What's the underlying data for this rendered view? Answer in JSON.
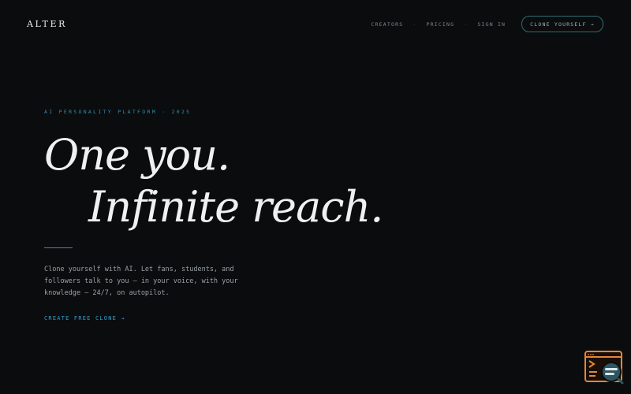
{
  "header": {
    "logo": "ALTER",
    "nav": {
      "items": [
        "CREATORS",
        "PRICING",
        "SIGN IN"
      ],
      "separator": "·",
      "cta_label": "CLONE YOURSELF →"
    }
  },
  "hero": {
    "eyebrow": "AI PERSONALITY PLATFORM · 2025",
    "headline_line1": "One you.",
    "headline_line2": "Infinite reach.",
    "description": "Clone yourself with AI. Let fans, students, and followers talk to you — in your voice, with your knowledge — 24/7, on autopilot.",
    "cta_label": "CREATE FREE CLONE →"
  },
  "colors": {
    "background": "#0b0c0d",
    "accent": "#2f8fb8",
    "widget_orange": "#e2873c",
    "widget_teal": "#2e5560"
  },
  "widget": {
    "icon": "terminal-search-icon"
  }
}
